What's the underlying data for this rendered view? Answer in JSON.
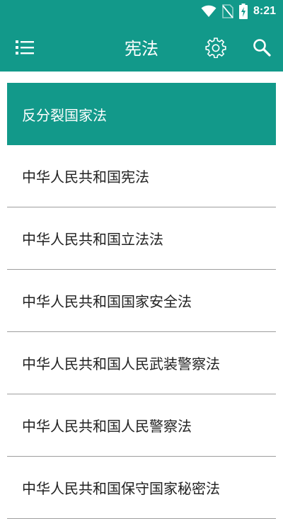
{
  "status_bar": {
    "time": "8:21",
    "icons": [
      "wifi-icon",
      "no-sim-icon",
      "battery-charging-icon"
    ]
  },
  "toolbar": {
    "title": "宪法",
    "menu_icon": "menu-icon",
    "settings_icon": "gear-icon",
    "search_icon": "search-icon"
  },
  "colors": {
    "primary": "#12998a",
    "text": "#222222",
    "divider": "#9e9e9e"
  },
  "list": {
    "items": [
      {
        "label": "反分裂国家法",
        "selected": true
      },
      {
        "label": "中华人民共和国宪法",
        "selected": false
      },
      {
        "label": "中华人民共和国立法法",
        "selected": false
      },
      {
        "label": "中华人民共和国国家安全法",
        "selected": false
      },
      {
        "label": "中华人民共和国人民武装警察法",
        "selected": false
      },
      {
        "label": "中华人民共和国人民警察法",
        "selected": false
      },
      {
        "label": "中华人民共和国保守国家秘密法",
        "selected": false
      }
    ]
  }
}
